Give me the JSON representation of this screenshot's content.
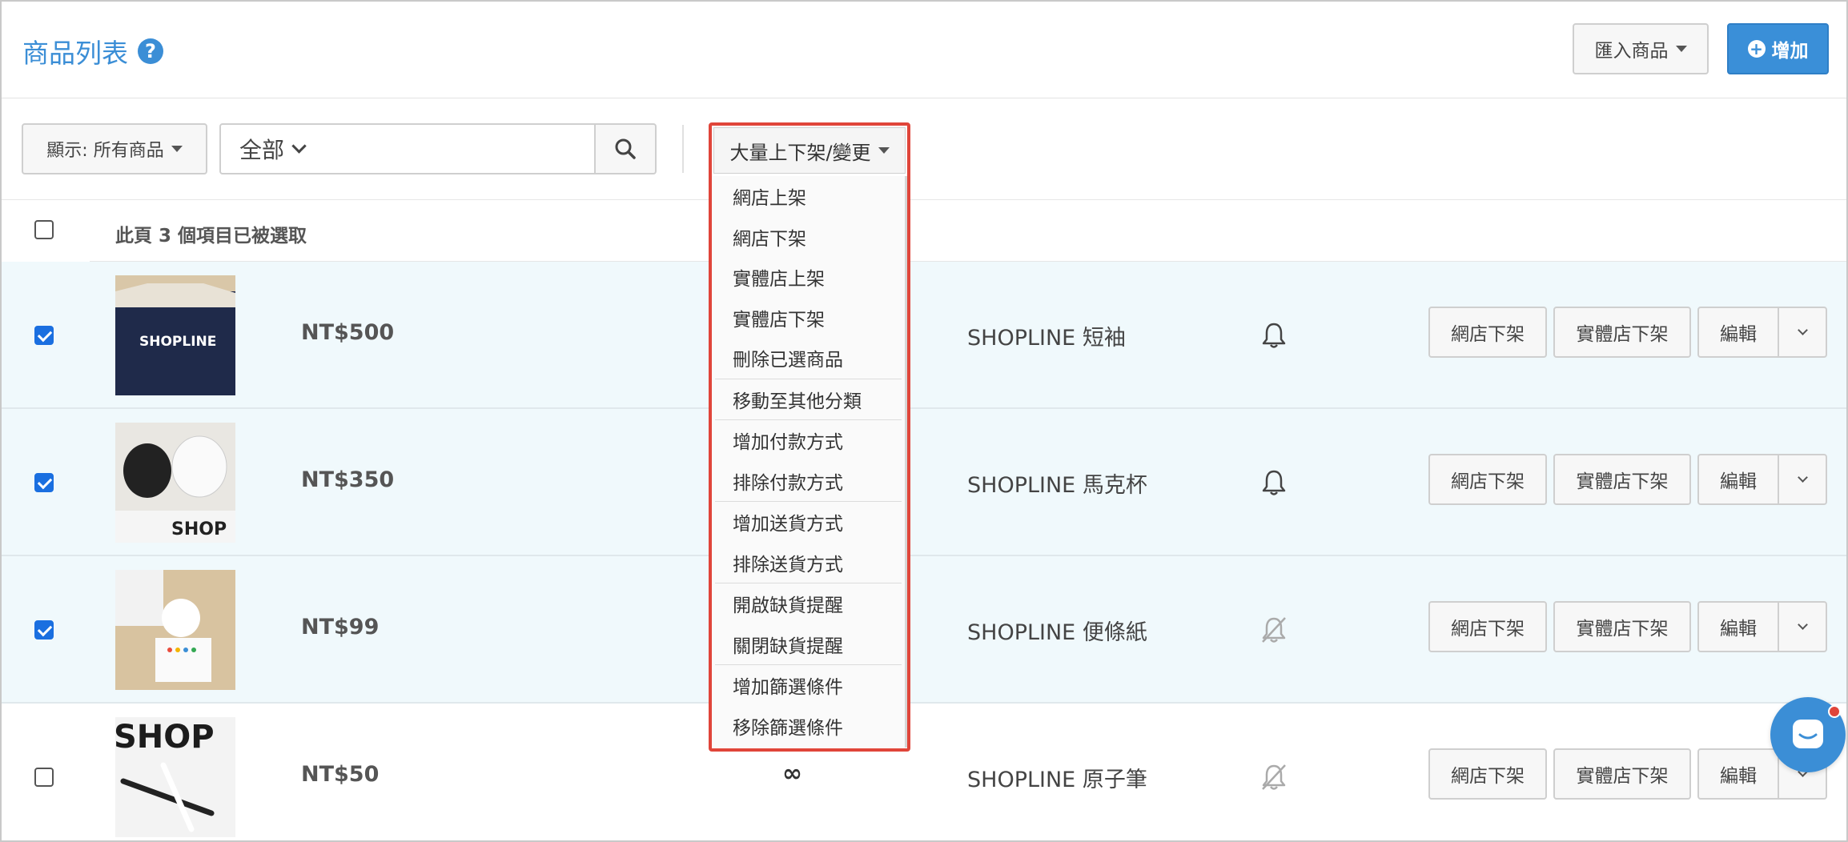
{
  "header": {
    "title": "商品列表",
    "help_icon": "question-circle-icon",
    "import_label": "匯入商品",
    "add_label": "增加"
  },
  "toolbar": {
    "filter_label": "顯示: 所有商品",
    "scope_label": "全部",
    "search_value": "",
    "bulk_label": "大量上下架/變更"
  },
  "bulk_menu": [
    [
      "網店上架",
      "網店下架",
      "實體店上架",
      "實體店下架",
      "刪除已選商品"
    ],
    [
      "移動至其他分類"
    ],
    [
      "增加付款方式",
      "排除付款方式"
    ],
    [
      "增加送貨方式",
      "排除送貨方式"
    ],
    [
      "開啟缺貨提醒",
      "關閉缺貨提醒"
    ],
    [
      "增加篩選條件",
      "移除篩選條件"
    ]
  ],
  "selection": {
    "label": "此頁 3 個項目已被選取"
  },
  "products": [
    {
      "price": "NT$500",
      "name": "SHOPLINE 短袖",
      "checked": true,
      "qty": "",
      "alert_icon": "bell-icon",
      "image": "navy t-shirt"
    },
    {
      "price": "NT$350",
      "name": "SHOPLINE 馬克杯",
      "checked": true,
      "qty": "",
      "alert_icon": "bell-icon",
      "image": "mugs"
    },
    {
      "price": "NT$99",
      "name": "SHOPLINE 便條紙",
      "checked": true,
      "qty": "",
      "alert_icon": "bell-slash-icon",
      "image": "sticky notes"
    },
    {
      "price": "NT$50",
      "name": "SHOPLINE 原子筆",
      "checked": false,
      "qty": "∞",
      "alert_icon": "bell-slash-icon",
      "image": "pens"
    }
  ],
  "row_actions": {
    "online_off": "網店下架",
    "store_off": "實體店下架",
    "edit": "編輯"
  },
  "colors": {
    "accent": "#3b8ed6",
    "highlight_border": "#e0453a",
    "selected_row_bg": "#f0f9fc",
    "checkbox": "#1a6fe0"
  }
}
